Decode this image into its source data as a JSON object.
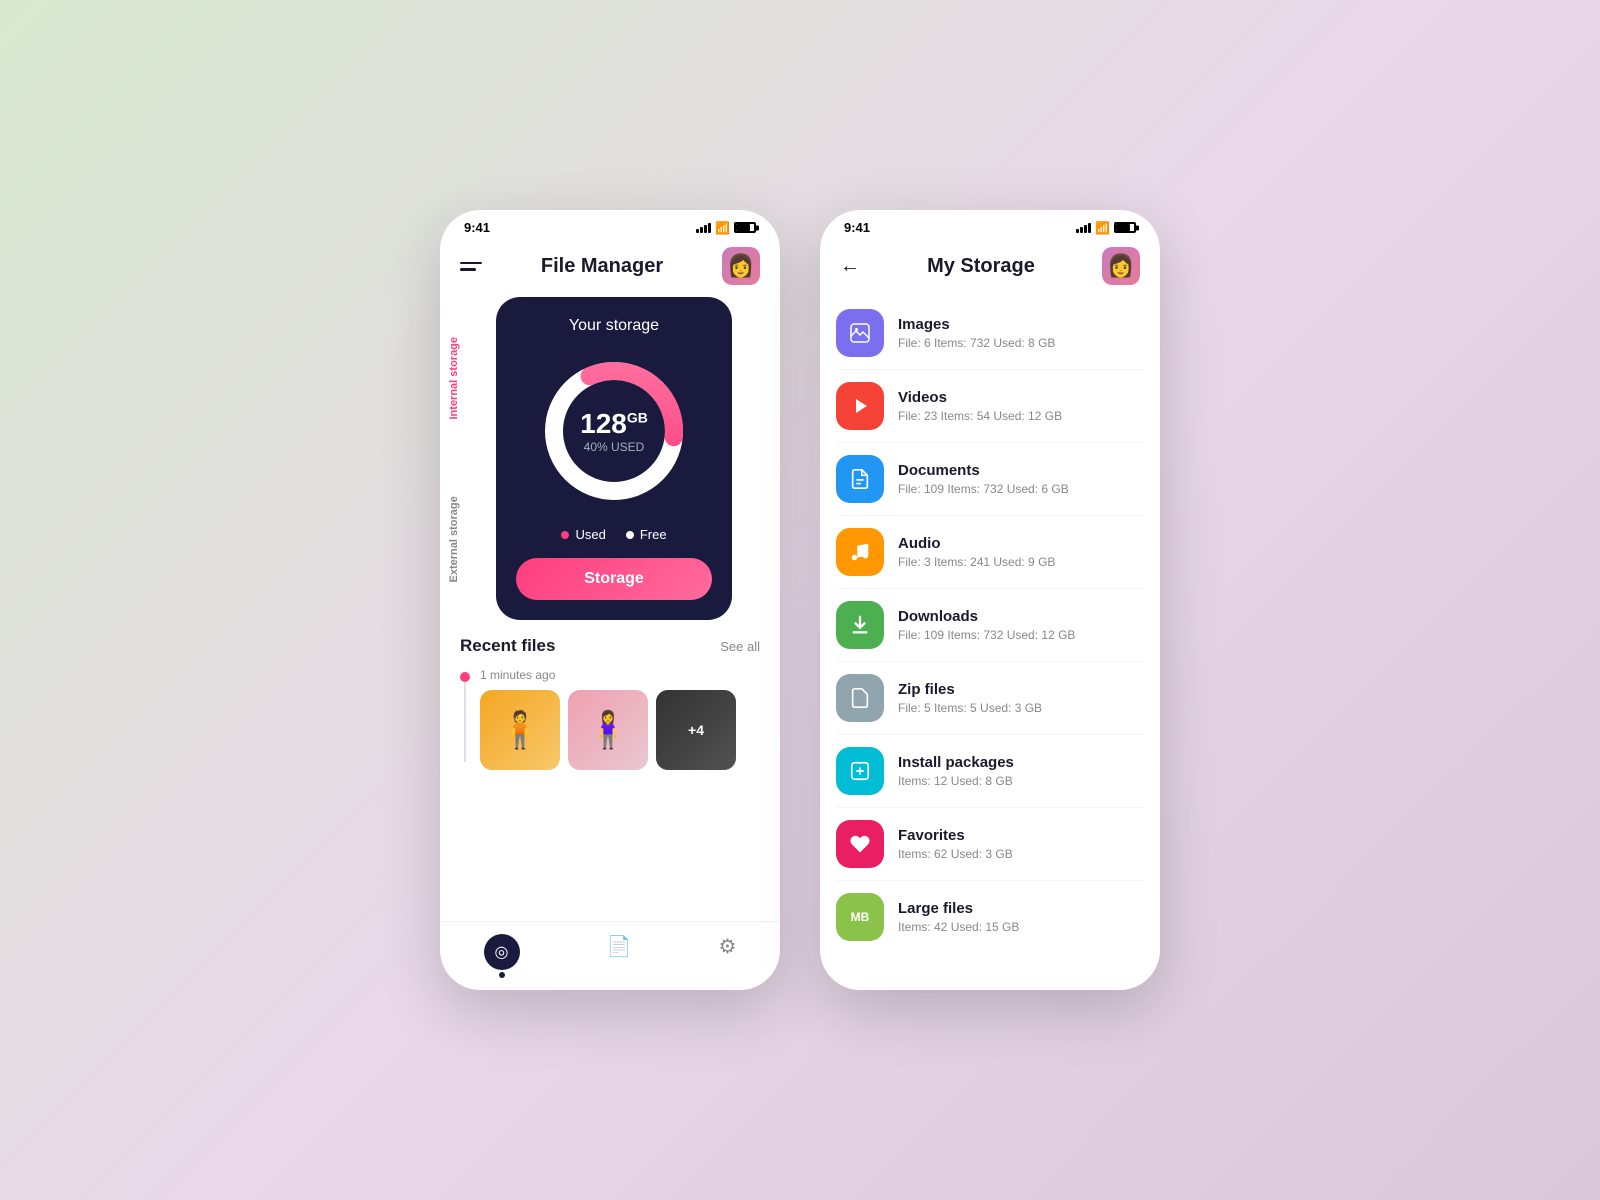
{
  "background": "linear-gradient(135deg, #d8e8d0 0%, #e8d8e8 50%, #d8c8d8 100%)",
  "phone1": {
    "status": {
      "time": "9:41"
    },
    "header": {
      "title": "File Manager"
    },
    "storage_card": {
      "label": "Your storage",
      "gb": "128",
      "gb_unit": "GB",
      "used_pct": "40% USED",
      "used_label": "Used",
      "free_label": "Free",
      "button_label": "Storage",
      "internal_label": "Internal storage",
      "external_label": "External storage"
    },
    "recent": {
      "title": "Recent files",
      "see_all": "See all",
      "time_ago": "1 minutes ago",
      "overlay": "+4"
    },
    "nav": {
      "home": "⊙",
      "file": "📄",
      "settings": "⚙"
    }
  },
  "phone2": {
    "status": {
      "time": "9:41"
    },
    "header": {
      "title": "My Storage",
      "back": "←"
    },
    "categories": [
      {
        "name": "Images",
        "meta": "File: 6   Items: 732   Used: 8 GB",
        "color_class": "cat-purple",
        "icon": "🖼"
      },
      {
        "name": "Videos",
        "meta": "File: 23   Items: 54   Used: 12 GB",
        "color_class": "cat-red",
        "icon": "▶"
      },
      {
        "name": "Documents",
        "meta": "File: 109   Items: 732   Used: 6 GB",
        "color_class": "cat-blue",
        "icon": "📄"
      },
      {
        "name": "Audio",
        "meta": "File: 3   Items: 241   Used: 9 GB",
        "color_class": "cat-orange",
        "icon": "♪"
      },
      {
        "name": "Downloads",
        "meta": "File: 109   Items: 732   Used: 12 GB",
        "color_class": "cat-green",
        "icon": "⬇"
      },
      {
        "name": "Zip files",
        "meta": "File: 5   Items: 5   Used: 3 GB",
        "color_class": "cat-bluegray",
        "icon": "🗜"
      },
      {
        "name": "Install packages",
        "meta": "Items: 12   Used: 8 GB",
        "color_class": "cat-cyan",
        "icon": "📦"
      },
      {
        "name": "Favorites",
        "meta": "Items: 62   Used: 3 GB",
        "color_class": "cat-pink",
        "icon": "♥"
      },
      {
        "name": "Large files",
        "meta": "Items: 42   Used: 15 GB",
        "color_class": "cat-lime",
        "icon": "MB"
      }
    ]
  }
}
